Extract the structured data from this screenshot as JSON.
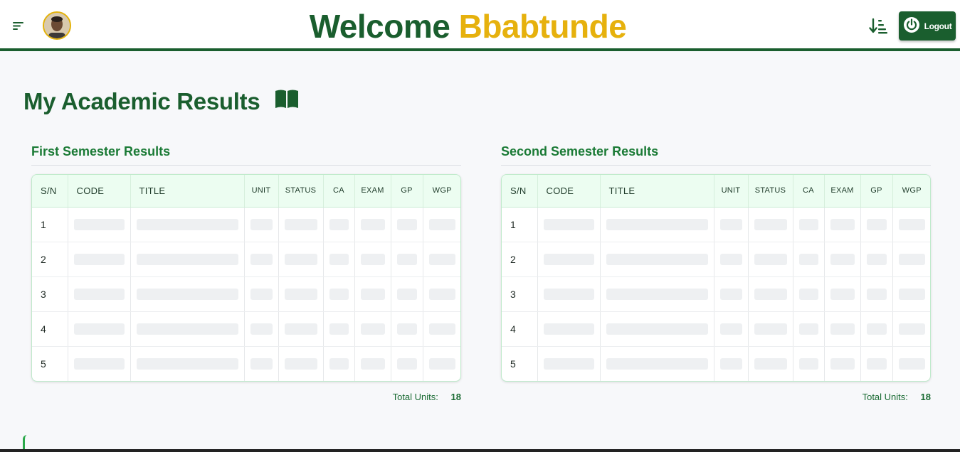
{
  "header": {
    "welcome_prefix": "Welcome",
    "user_name": "Bbabtunde",
    "logout_label": "Logout",
    "brand_color": "#1a5e2e",
    "accent_color": "#e6b10d"
  },
  "page": {
    "title": "My Academic Results",
    "title_icon": "book-icon"
  },
  "first_semester": {
    "title": "First Semester Results",
    "columns": [
      "S/N",
      "CODE",
      "TITLE",
      "UNIT",
      "STATUS",
      "CA",
      "EXAM",
      "GP",
      "WGP"
    ],
    "rows": [
      "1",
      "2",
      "3",
      "4",
      "5"
    ],
    "total_label": "Total Units:",
    "total_value": "18"
  },
  "second_semester": {
    "title": "Second Semester Results",
    "columns": [
      "S/N",
      "CODE",
      "TITLE",
      "UNIT",
      "STATUS",
      "CA",
      "EXAM",
      "GP",
      "WGP"
    ],
    "rows": [
      "1",
      "2",
      "3",
      "4",
      "5"
    ],
    "total_label": "Total Units:",
    "total_value": "18"
  },
  "icons": [
    "menu-icon",
    "avatar",
    "sort-icon",
    "power-icon",
    "book-icon"
  ]
}
